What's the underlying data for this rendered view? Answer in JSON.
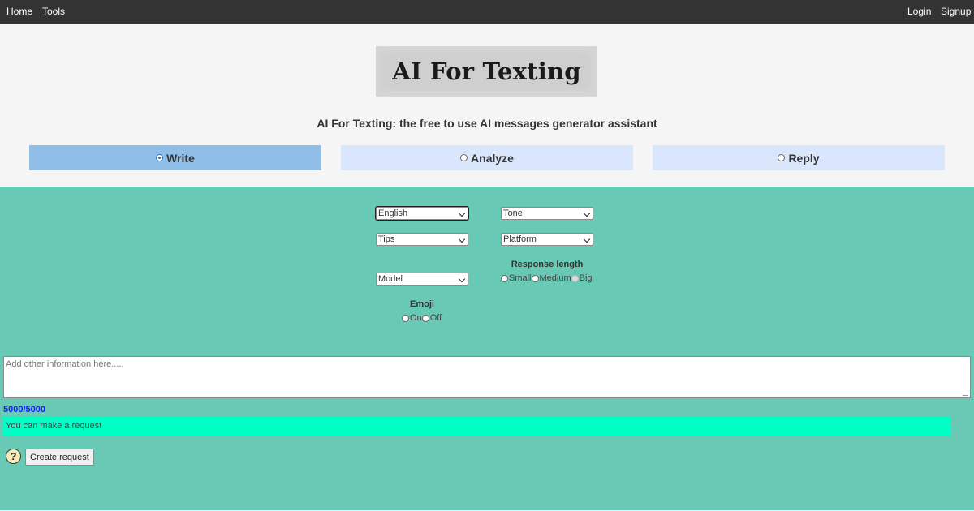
{
  "nav": {
    "home": "Home",
    "tools": "Tools",
    "login": "Login",
    "signup": "Signup"
  },
  "header": {
    "logo_text": "AI For Texting",
    "subtitle": "AI For Texting: the free to use AI messages generator assistant"
  },
  "modes": [
    {
      "label": "Write",
      "selected": true
    },
    {
      "label": "Analyze",
      "selected": false
    },
    {
      "label": "Reply",
      "selected": false
    }
  ],
  "controls": {
    "language": "English",
    "tone": "Tone",
    "tips": "Tips",
    "platform": "Platform",
    "model": "Model",
    "response_length": {
      "title": "Response length",
      "options": [
        "Small",
        "Medium",
        "Big"
      ]
    },
    "emoji": {
      "title": "Emoji",
      "options": [
        "On",
        "Off"
      ]
    }
  },
  "input": {
    "placeholder": "Add other information here.....",
    "counter": "5000/5000"
  },
  "status": "You can make a request",
  "actions": {
    "help": "?",
    "create": "Create request"
  },
  "colors": {
    "nav_bg": "#333333",
    "main_bg": "#68c9b4",
    "tab_active": "#8fbfe9",
    "tab_inactive": "#d9e6fb",
    "status_bg": "#00ffc4",
    "counter": "#1a1aff"
  }
}
